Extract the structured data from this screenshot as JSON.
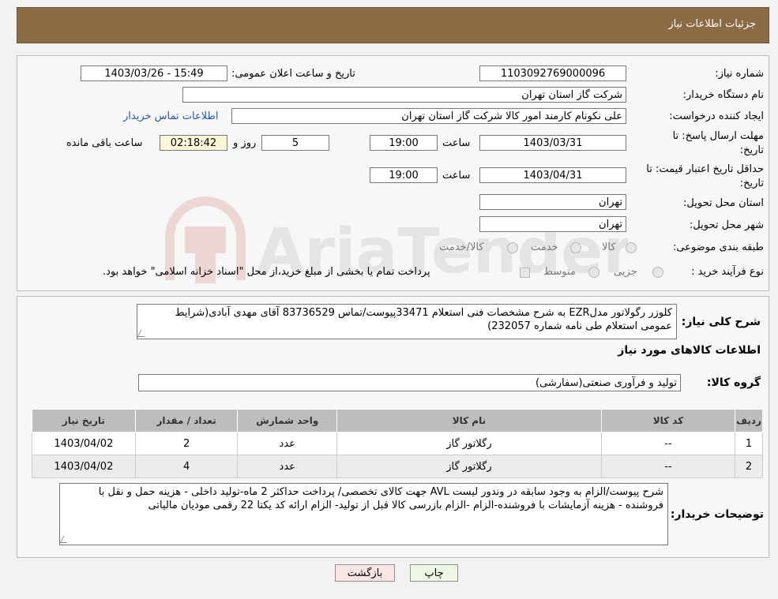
{
  "header": {
    "title": "جزئیات اطلاعات نیاز"
  },
  "form": {
    "need_number_label": "شماره نیاز:",
    "need_number": "1103092769000096",
    "announce_label": "تاریخ و ساعت اعلان عمومی:",
    "announce_value": "1403/03/26 - 15:49",
    "buyer_org_label": "نام دستگاه خریدار:",
    "buyer_org": "شرکت گاز استان تهران",
    "creator_label": "ایجاد کننده درخواست:",
    "creator": "علی نکونام کارمند امور کالا شرکت گاز استان تهران",
    "contact_link": "اطلاعات تماس خریدار",
    "deadline_label_1": "مهلت ارسال پاسخ: تا",
    "deadline_label_2": "تاریخ:",
    "deadline_date": "1403/03/31",
    "time_label": "ساعت",
    "deadline_time": "19:00",
    "days_value": "5",
    "days_label": "روز و",
    "remaining_time": "02:18:42",
    "remaining_label": "ساعت باقی مانده",
    "validity_label_1": "حداقل تاریخ اعتبار قیمت: تا",
    "validity_label_2": "تاریخ:",
    "validity_date": "1403/04/31",
    "validity_time": "19:00",
    "province_label": "استان محل تحویل:",
    "province": "تهران",
    "city_label": "شهر محل تحویل:",
    "city": "تهران",
    "category_label": "طبقه بندی موضوعی:",
    "category_options": [
      "کالا",
      "خدمت",
      "کالا/خدمت"
    ],
    "process_label": "نوع فرآیند خرید :",
    "process_options": [
      "جزیی",
      "متوسط"
    ],
    "payment_note": "پرداخت تمام یا بخشی از مبلغ خرید،از محل \"اسناد خزانه اسلامی\" خواهد بود."
  },
  "general": {
    "description_label": "شرح کلی نیاز:",
    "description": "کلوزر رگولاتور مدلEZR به شرح مشخصات فنی استعلام 33471پیوست/تماس 83736529 آقای مهدی آبادی(شرایط عمومی استعلام طی نامه شماره 232057)",
    "goods_info_title": "اطلاعات کالاهای مورد نیاز",
    "goods_group_label": "گروه کالا:",
    "goods_group": "تولید و فرآوری صنعتی(سفارشی)"
  },
  "table": {
    "headers": [
      "ردیف",
      "کد کالا",
      "نام کالا",
      "واحد شمارش",
      "تعداد / مقدار",
      "تاریخ نیاز"
    ],
    "rows": [
      {
        "row": "1",
        "code": "--",
        "name": "رگلاتور گاز",
        "unit": "عدد",
        "qty": "2",
        "date": "1403/04/02"
      },
      {
        "row": "2",
        "code": "--",
        "name": "رگلاتور گاز",
        "unit": "عدد",
        "qty": "4",
        "date": "1403/04/02"
      }
    ]
  },
  "buyer_notes": {
    "label": "توضیحات خریدار:",
    "text": "شرح پیوست/الزام به وجود سابقه در وندور لیست AVL جهت کالای تخصصی/ پرداخت حداکثر 2 ماه-تولید داخلی - هزینه حمل و نقل با فروشنده - هزینه آزمایشات با فروشنده-الزام  -الزام بازرسی کالا قبل از تولید- الزام ارائه کد یکتا 22 رقمی مودیان مالیاتی"
  },
  "buttons": {
    "print": "چاپ",
    "back": "بازگشت"
  },
  "watermark": {
    "text": "AriaTender.neT"
  },
  "colors": {
    "header_bg": "#8b6b43",
    "print_bg": "#eef7e4",
    "back_bg": "#fbe6e6",
    "link": "#2a56a8"
  }
}
